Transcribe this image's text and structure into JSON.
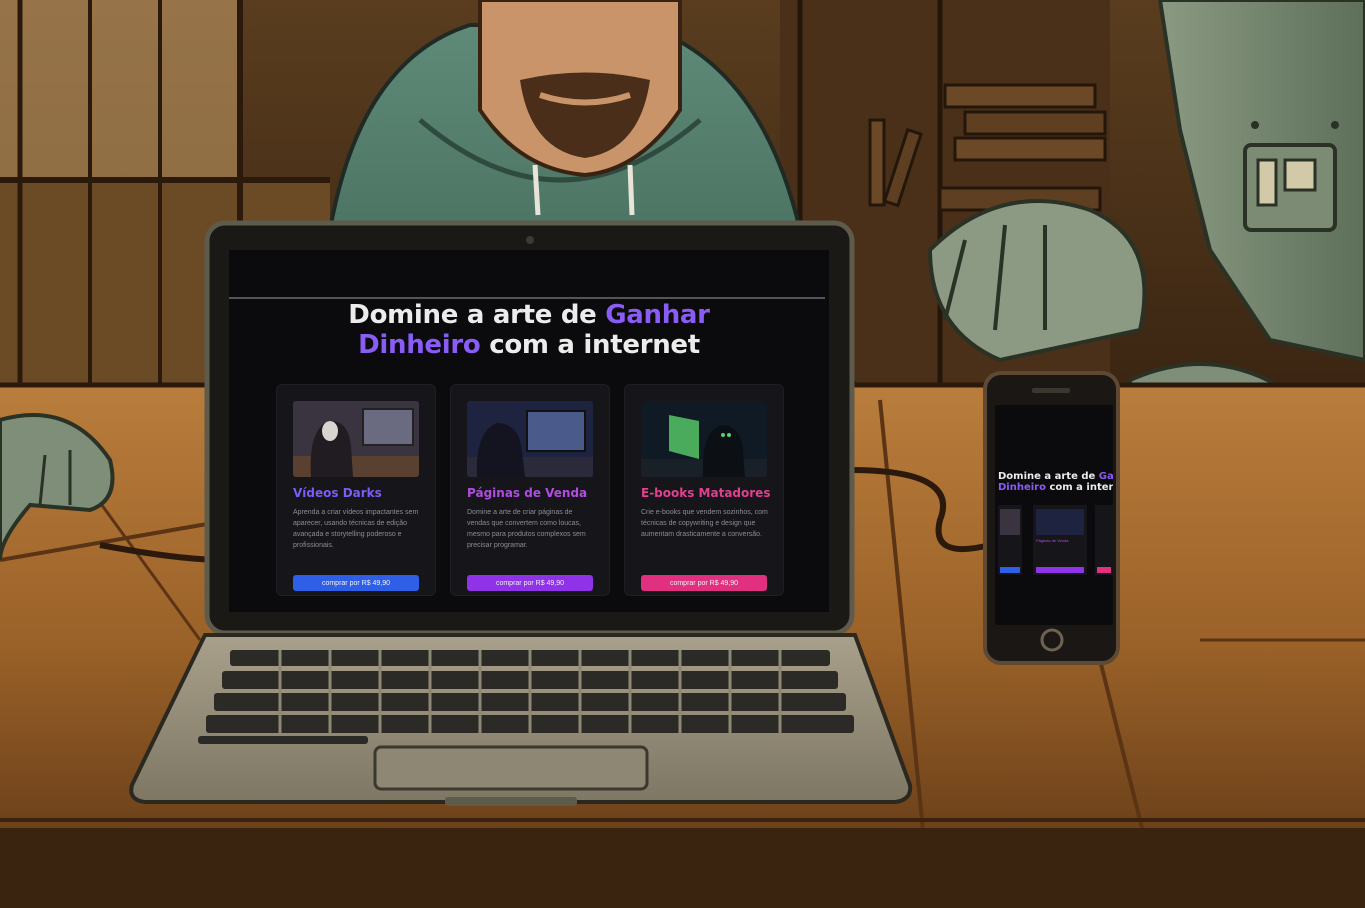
{
  "laptop_page": {
    "headline": {
      "part1": "Domine a arte de ",
      "accent1": "Ganhar",
      "accent2": "Dinheiro",
      "part2": " com a internet"
    },
    "cards": [
      {
        "title": "Vídeos Darks",
        "title_color": "#7b5cf5",
        "description": "Aprenda a criar vídeos impactantes sem aparecer, usando técnicas de edição avançada e storytelling poderoso e profissionais.",
        "button_label": "comprar por R$ 49,90",
        "button_color": "#2f5fe6"
      },
      {
        "title": "Páginas de Venda",
        "title_color": "#b04de0",
        "description": "Domine a arte de criar páginas de vendas que convertem como loucas, mesmo para produtos complexos sem precisar programar.",
        "button_label": "comprar por R$ 49,90",
        "button_color": "#8f32e8"
      },
      {
        "title": "E-books Matadores",
        "title_color": "#e0408f",
        "description": "Crie e-books que vendem sozinhos, com técnicas de copywriting e design que aumentam drasticamente a conversão.",
        "button_label": "comprar por R$ 49,90",
        "button_color": "#e0307f"
      }
    ]
  },
  "phone_page": {
    "headline_line1_a": "Domine a arte de ",
    "headline_line1_b": "Gan",
    "headline_line2_a": "Dinheiro",
    "headline_line2_b": " com a inter",
    "card_label": "Páginas de Venda"
  },
  "colors": {
    "accent": "#8a5cf6",
    "screen_bg": "#0b0a0d"
  }
}
